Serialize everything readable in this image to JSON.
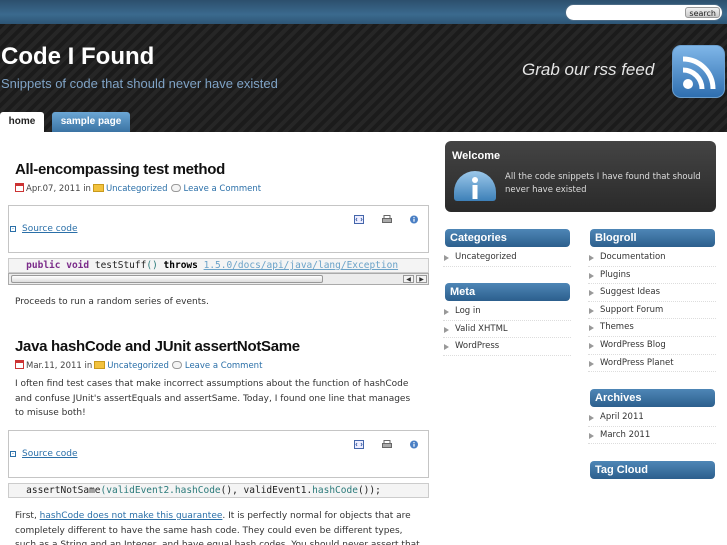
{
  "search": {
    "placeholder": "",
    "button_label": "search"
  },
  "header": {
    "title": "Code I Found",
    "tagline": "Snippets of code that should never have existed",
    "rss_text": "Grab our rss feed"
  },
  "nav": {
    "tabs": [
      {
        "label": "home"
      },
      {
        "label": "sample page"
      }
    ]
  },
  "posts": [
    {
      "title": "All-encompassing test method",
      "date": "Apr.07, 2011",
      "in_label": "in",
      "category": "Uncategorized",
      "comment": "Leave a Comment",
      "source_label": "Source code",
      "code": {
        "kw1": "public",
        "kw2": "void",
        "name": "testStuff",
        "paren": "()",
        "throws": "throws",
        "link": "1.5.0/docs/api/java/lang/Exception"
      },
      "body": "Proceeds to run a random series of events."
    },
    {
      "title": "Java hashCode and JUnit assertNotSame",
      "date": "Mar.11, 2011",
      "in_label": "in",
      "category": "Uncategorized",
      "comment": "Leave a Comment",
      "intro": "I often find test cases that make incorrect assumptions about the function of hashCode and confuse JUnit's assertEquals and assertSame. Today, I found one line that manages to misuse both!",
      "source_label": "Source code",
      "code": {
        "fn": "assertNotSame",
        "args": "(validEvent2.",
        "m1": "hashCode",
        "mid": "(), validEvent1.",
        "m2": "hashCode",
        "end": "());"
      },
      "body_prefix": "First, ",
      "body_link": "hashCode does not make this guarantee",
      "body_rest": ". It is perfectly normal for objects that are completely different to have the same hash code. They could even be different types, such as a String and an Integer, and have equal hash codes. You should never assert that two"
    }
  ],
  "sidebar": {
    "welcome": {
      "title": "Welcome",
      "text": "All the code snippets I have found that should never have existed"
    },
    "categories": {
      "title": "Categories",
      "items": [
        "Uncategorized"
      ]
    },
    "meta": {
      "title": "Meta",
      "items": [
        "Log in",
        "Valid XHTML",
        "WordPress"
      ]
    },
    "blogroll": {
      "title": "Blogroll",
      "items": [
        "Documentation",
        "Plugins",
        "Suggest Ideas",
        "Support Forum",
        "Themes",
        "WordPress Blog",
        "WordPress Planet"
      ]
    },
    "archives": {
      "title": "Archives",
      "items": [
        "April 2011",
        "March 2011"
      ]
    },
    "tagcloud": {
      "title": "Tag Cloud"
    }
  }
}
